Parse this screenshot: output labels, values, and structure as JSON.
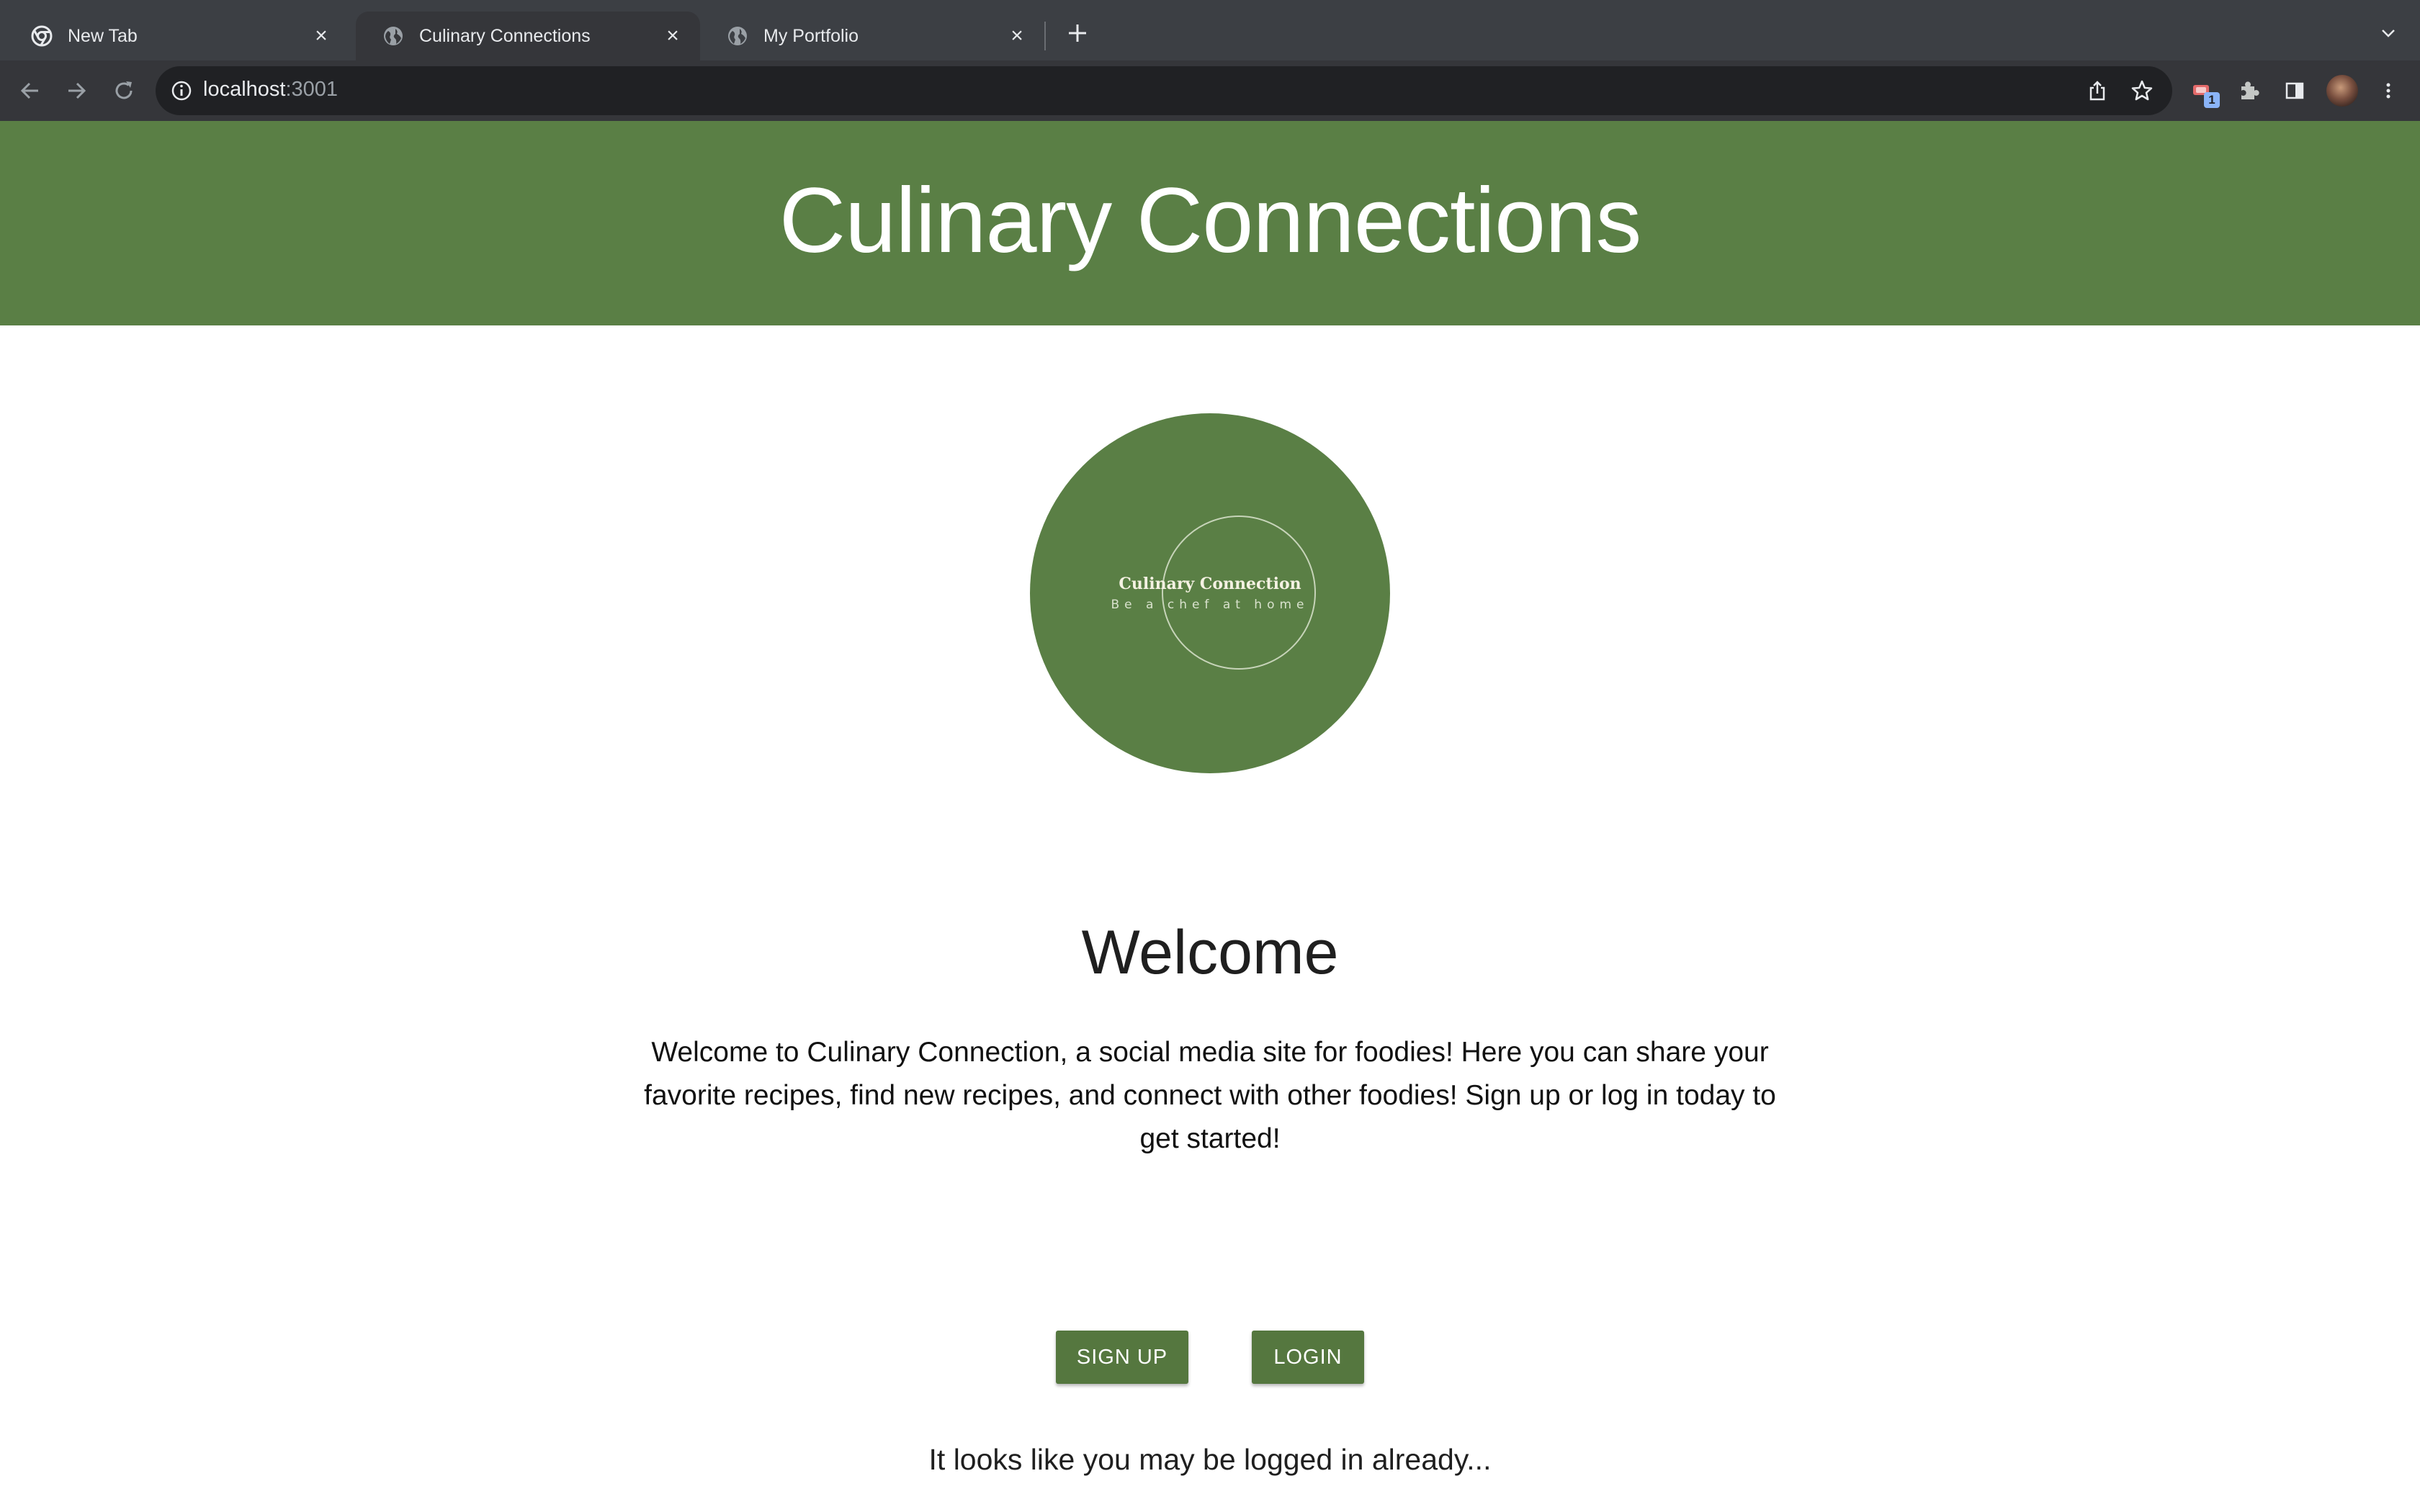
{
  "browser": {
    "tabs": [
      {
        "title": "New Tab",
        "icon": "chrome-icon",
        "active": false
      },
      {
        "title": "Culinary Connections",
        "icon": "globe-icon",
        "active": true
      },
      {
        "title": "My Portfolio",
        "icon": "globe-icon",
        "active": false
      }
    ],
    "url": {
      "host": "localhost",
      "port": ":3001"
    },
    "extension_badge": "1"
  },
  "header": {
    "title": "Culinary Connections"
  },
  "logo": {
    "name": "Culinary Connection",
    "tagline": "Be a chef at home"
  },
  "main": {
    "heading": "Welcome",
    "intro": "Welcome to Culinary Connection, a social media site for foodies! Here you can share your favorite recipes, find new recipes, and connect with other foodies! Sign up or log in today to get started!",
    "signup_label": "SIGN UP",
    "login_label": "LOGIN",
    "status": "It looks like you may be logged in already..."
  },
  "colors": {
    "brand_green": "#5a7f45",
    "button_green": "#55773f"
  }
}
